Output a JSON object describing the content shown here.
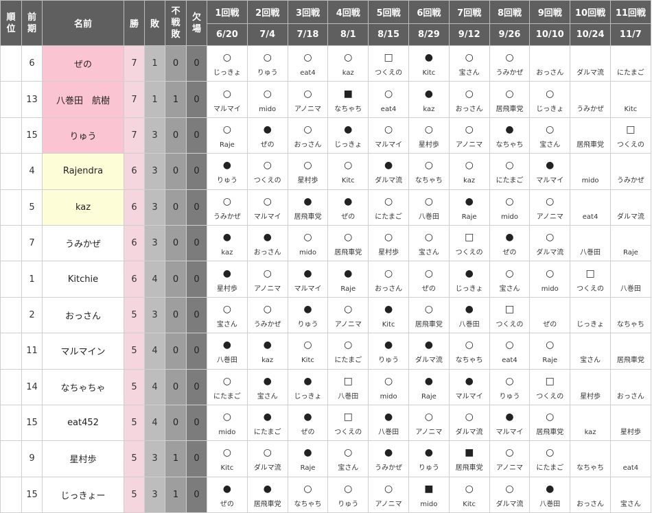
{
  "header": {
    "rank": "順\n位",
    "prev": "前\n期",
    "name": "名前",
    "wins": "勝",
    "losses": "敗",
    "forfeit": "不\n戦\n敗",
    "absent": "欠\n場",
    "rounds": [
      {
        "label": "1回戦",
        "date": "6/20"
      },
      {
        "label": "2回戦",
        "date": "7/4"
      },
      {
        "label": "3回戦",
        "date": "7/18"
      },
      {
        "label": "4回戦",
        "date": "8/1"
      },
      {
        "label": "5回戦",
        "date": "8/15"
      },
      {
        "label": "6回戦",
        "date": "8/29"
      },
      {
        "label": "7回戦",
        "date": "9/12"
      },
      {
        "label": "8回戦",
        "date": "9/26"
      },
      {
        "label": "9回戦",
        "date": "10/10"
      },
      {
        "label": "10回戦",
        "date": "10/24"
      },
      {
        "label": "11回戦",
        "date": "11/7"
      }
    ]
  },
  "colors": {
    "pink": "#fbc4d2",
    "yellow": "#fdfdd8",
    "header": "#5f5f5f"
  },
  "rows": [
    {
      "rank": "",
      "prev": "6",
      "name": "ぜの",
      "hl": "pink",
      "w": "7",
      "l": "1",
      "f": "0",
      "a": "0",
      "m": [
        [
          "○",
          "じっきょ"
        ],
        [
          "○",
          "りゅう"
        ],
        [
          "○",
          "eat4"
        ],
        [
          "○",
          "kaz"
        ],
        [
          "□",
          "つくえの"
        ],
        [
          "●",
          "Kitc"
        ],
        [
          "○",
          "宝さん"
        ],
        [
          "○",
          "うみかぜ"
        ],
        [
          "",
          "おっさん"
        ],
        [
          "",
          "ダルマ流"
        ],
        [
          "",
          "にたまご"
        ]
      ]
    },
    {
      "rank": "",
      "prev": "13",
      "name": "八巻田　航樹",
      "hl": "pink",
      "w": "7",
      "l": "1",
      "f": "1",
      "a": "0",
      "m": [
        [
          "○",
          "マルマイ"
        ],
        [
          "○",
          "mido"
        ],
        [
          "○",
          "アノニマ"
        ],
        [
          "■",
          "なちゃち"
        ],
        [
          "○",
          "eat4"
        ],
        [
          "●",
          "kaz"
        ],
        [
          "○",
          "おっさん"
        ],
        [
          "○",
          "居飛車党"
        ],
        [
          "○",
          "じっきょ"
        ],
        [
          "",
          "うみかぜ"
        ],
        [
          "",
          "Kitc"
        ]
      ]
    },
    {
      "rank": "",
      "prev": "15",
      "name": "りゅう",
      "hl": "pink",
      "w": "7",
      "l": "3",
      "f": "0",
      "a": "0",
      "m": [
        [
          "○",
          "Raje"
        ],
        [
          "●",
          "ぜの"
        ],
        [
          "○",
          "おっさん"
        ],
        [
          "●",
          "じっきょ"
        ],
        [
          "○",
          "マルマイ"
        ],
        [
          "○",
          "星村歩"
        ],
        [
          "○",
          "アノニマ"
        ],
        [
          "●",
          "なちゃち"
        ],
        [
          "○",
          "宝さん"
        ],
        [
          "",
          "居飛車党"
        ],
        [
          "□",
          "つくえの"
        ]
      ]
    },
    {
      "rank": "",
      "prev": "4",
      "name": "Rajendra",
      "hl": "yellow",
      "w": "6",
      "l": "3",
      "f": "0",
      "a": "0",
      "m": [
        [
          "●",
          "りゅう"
        ],
        [
          "○",
          "つくえの"
        ],
        [
          "○",
          "星村歩"
        ],
        [
          "○",
          "Kitc"
        ],
        [
          "●",
          "ダルマ流"
        ],
        [
          "○",
          "なちゃち"
        ],
        [
          "○",
          "kaz"
        ],
        [
          "○",
          "にたまご"
        ],
        [
          "●",
          "マルマイ"
        ],
        [
          "",
          "mido"
        ],
        [
          "",
          "うみかぜ"
        ]
      ]
    },
    {
      "rank": "",
      "prev": "5",
      "name": "kaz",
      "hl": "yellow",
      "w": "6",
      "l": "3",
      "f": "0",
      "a": "0",
      "m": [
        [
          "○",
          "うみかぜ"
        ],
        [
          "○",
          "マルマイ"
        ],
        [
          "●",
          "居飛車党"
        ],
        [
          "●",
          "ぜの"
        ],
        [
          "○",
          "にたまご"
        ],
        [
          "○",
          "八巻田"
        ],
        [
          "●",
          "Raje"
        ],
        [
          "○",
          "mido"
        ],
        [
          "○",
          "アノニマ"
        ],
        [
          "",
          "eat4"
        ],
        [
          "",
          "ダルマ流"
        ]
      ]
    },
    {
      "rank": "",
      "prev": "7",
      "name": "うみかぜ",
      "hl": "",
      "w": "6",
      "l": "3",
      "f": "0",
      "a": "0",
      "m": [
        [
          "●",
          "kaz"
        ],
        [
          "●",
          "おっさん"
        ],
        [
          "○",
          "mido"
        ],
        [
          "○",
          "居飛車党"
        ],
        [
          "○",
          "星村歩"
        ],
        [
          "○",
          "宝さん"
        ],
        [
          "□",
          "つくえの"
        ],
        [
          "●",
          "ぜの"
        ],
        [
          "○",
          "ダルマ流"
        ],
        [
          "",
          "八巻田"
        ],
        [
          "",
          "Raje"
        ]
      ]
    },
    {
      "rank": "",
      "prev": "1",
      "name": "Kitchie",
      "hl": "",
      "w": "6",
      "l": "4",
      "f": "0",
      "a": "0",
      "m": [
        [
          "●",
          "星村歩"
        ],
        [
          "○",
          "アノニマ"
        ],
        [
          "●",
          "マルマイ"
        ],
        [
          "●",
          "Raje"
        ],
        [
          "○",
          "おっさん"
        ],
        [
          "○",
          "ぜの"
        ],
        [
          "●",
          "じっきょ"
        ],
        [
          "○",
          "宝さん"
        ],
        [
          "○",
          "mido"
        ],
        [
          "□",
          "つくえの"
        ],
        [
          "",
          "八巻田"
        ]
      ]
    },
    {
      "rank": "",
      "prev": "2",
      "name": "おっさん",
      "hl": "",
      "w": "5",
      "l": "3",
      "f": "0",
      "a": "0",
      "m": [
        [
          "○",
          "宝さん"
        ],
        [
          "○",
          "うみかぜ"
        ],
        [
          "●",
          "りゅう"
        ],
        [
          "○",
          "アノニマ"
        ],
        [
          "●",
          "Kitc"
        ],
        [
          "○",
          "居飛車党"
        ],
        [
          "●",
          "八巻田"
        ],
        [
          "□",
          "つくえの"
        ],
        [
          "",
          "ぜの"
        ],
        [
          "",
          "じっきょ"
        ],
        [
          "",
          "なちゃち"
        ]
      ]
    },
    {
      "rank": "",
      "prev": "11",
      "name": "マルマイン",
      "hl": "",
      "w": "5",
      "l": "4",
      "f": "0",
      "a": "0",
      "m": [
        [
          "●",
          "八巻田"
        ],
        [
          "●",
          "kaz"
        ],
        [
          "○",
          "Kitc"
        ],
        [
          "○",
          "にたまご"
        ],
        [
          "●",
          "りゅう"
        ],
        [
          "●",
          "ダルマ流"
        ],
        [
          "○",
          "なちゃち"
        ],
        [
          "○",
          "eat4"
        ],
        [
          "○",
          "Raje"
        ],
        [
          "",
          "宝さん"
        ],
        [
          "",
          "居飛車党"
        ]
      ]
    },
    {
      "rank": "",
      "prev": "14",
      "name": "なちゃちゃ",
      "hl": "",
      "w": "5",
      "l": "4",
      "f": "0",
      "a": "0",
      "m": [
        [
          "○",
          "にたまご"
        ],
        [
          "●",
          "宝さん"
        ],
        [
          "●",
          "じっきょ"
        ],
        [
          "□",
          "八巻田"
        ],
        [
          "○",
          "mido"
        ],
        [
          "●",
          "Raje"
        ],
        [
          "●",
          "マルマイ"
        ],
        [
          "○",
          "りゅう"
        ],
        [
          "□",
          "つくえの"
        ],
        [
          "",
          "星村歩"
        ],
        [
          "",
          "おっさん"
        ]
      ]
    },
    {
      "rank": "",
      "prev": "15",
      "name": "eat452",
      "hl": "",
      "w": "5",
      "l": "4",
      "f": "0",
      "a": "0",
      "m": [
        [
          "○",
          "mido"
        ],
        [
          "●",
          "にたまご"
        ],
        [
          "●",
          "ぜの"
        ],
        [
          "□",
          "つくえの"
        ],
        [
          "●",
          "八巻田"
        ],
        [
          "○",
          "アノニマ"
        ],
        [
          "○",
          "ダルマ流"
        ],
        [
          "●",
          "マルマイ"
        ],
        [
          "○",
          "居飛車党"
        ],
        [
          "",
          "kaz"
        ],
        [
          "",
          "星村歩"
        ]
      ]
    },
    {
      "rank": "",
      "prev": "9",
      "name": "星村歩",
      "hl": "",
      "w": "5",
      "l": "3",
      "f": "1",
      "a": "0",
      "m": [
        [
          "○",
          "Kitc"
        ],
        [
          "○",
          "ダルマ流"
        ],
        [
          "●",
          "Raje"
        ],
        [
          "○",
          "宝さん"
        ],
        [
          "●",
          "うみかぜ"
        ],
        [
          "●",
          "りゅう"
        ],
        [
          "■",
          "居飛車党"
        ],
        [
          "○",
          "アノニマ"
        ],
        [
          "○",
          "にたまご"
        ],
        [
          "",
          "なちゃち"
        ],
        [
          "",
          "eat4"
        ]
      ]
    },
    {
      "rank": "",
      "prev": "15",
      "name": "じっきょー",
      "hl": "",
      "w": "5",
      "l": "3",
      "f": "1",
      "a": "0",
      "m": [
        [
          "●",
          "ぜの"
        ],
        [
          "●",
          "居飛車党"
        ],
        [
          "○",
          "なちゃち"
        ],
        [
          "○",
          "りゅう"
        ],
        [
          "○",
          "アノニマ"
        ],
        [
          "■",
          "mido"
        ],
        [
          "○",
          "Kitc"
        ],
        [
          "○",
          "ダルマ流"
        ],
        [
          "●",
          "八巻田"
        ],
        [
          "",
          "おっさん"
        ],
        [
          "",
          "宝さん"
        ]
      ]
    }
  ]
}
